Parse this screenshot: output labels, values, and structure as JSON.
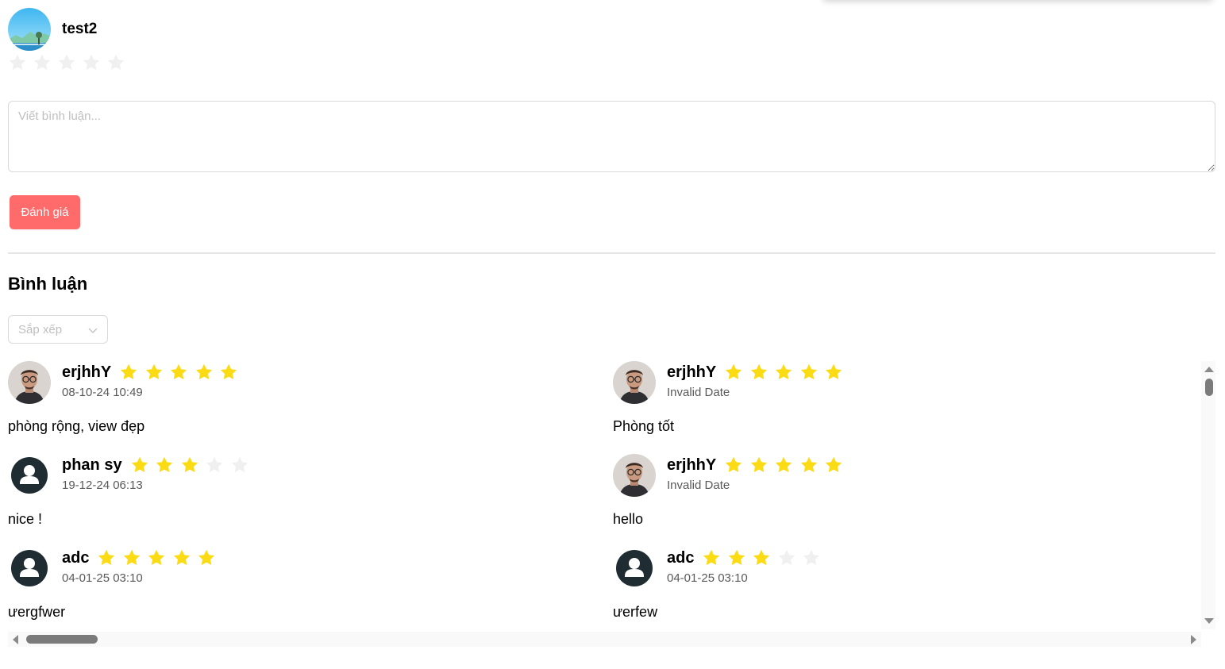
{
  "current_user": {
    "name": "test2",
    "avatar_icon": "landscape-avatar-icon",
    "rating_selected": 0,
    "rating_max": 5
  },
  "comment_form": {
    "placeholder": "Viết bình luận...",
    "value": "",
    "submit_label": "Đánh giá"
  },
  "comments_section": {
    "title": "Bình luận",
    "sort_placeholder": "Sắp xếp",
    "reviews": [
      {
        "name": "erjhhY",
        "date": "08-10-24 10:49",
        "rating": 5,
        "text": "phòng rộng, view đẹp",
        "avatar": "man-glasses-avatar-icon"
      },
      {
        "name": "erjhhY",
        "date": "Invalid Date",
        "rating": 5,
        "text": "Phòng tốt",
        "avatar": "man-glasses-avatar-icon"
      },
      {
        "name": "phan sy",
        "date": "19-12-24 06:13",
        "rating": 3,
        "text": "nice !",
        "avatar": "default-user-avatar-icon"
      },
      {
        "name": "erjhhY",
        "date": "Invalid Date",
        "rating": 5,
        "text": "hello",
        "avatar": "man-glasses-avatar-icon"
      },
      {
        "name": "adc",
        "date": "04-01-25 03:10",
        "rating": 5,
        "text": "ưergfwer",
        "avatar": "default-user-avatar-icon"
      },
      {
        "name": "adc",
        "date": "04-01-25 03:10",
        "rating": 3,
        "text": "ưerfew",
        "avatar": "default-user-avatar-icon"
      }
    ]
  },
  "colors": {
    "star_filled": "#fadb14",
    "star_empty": "#f0f0f0",
    "button_bg": "#ff6b6b",
    "default_avatar": "#1f2d33"
  }
}
